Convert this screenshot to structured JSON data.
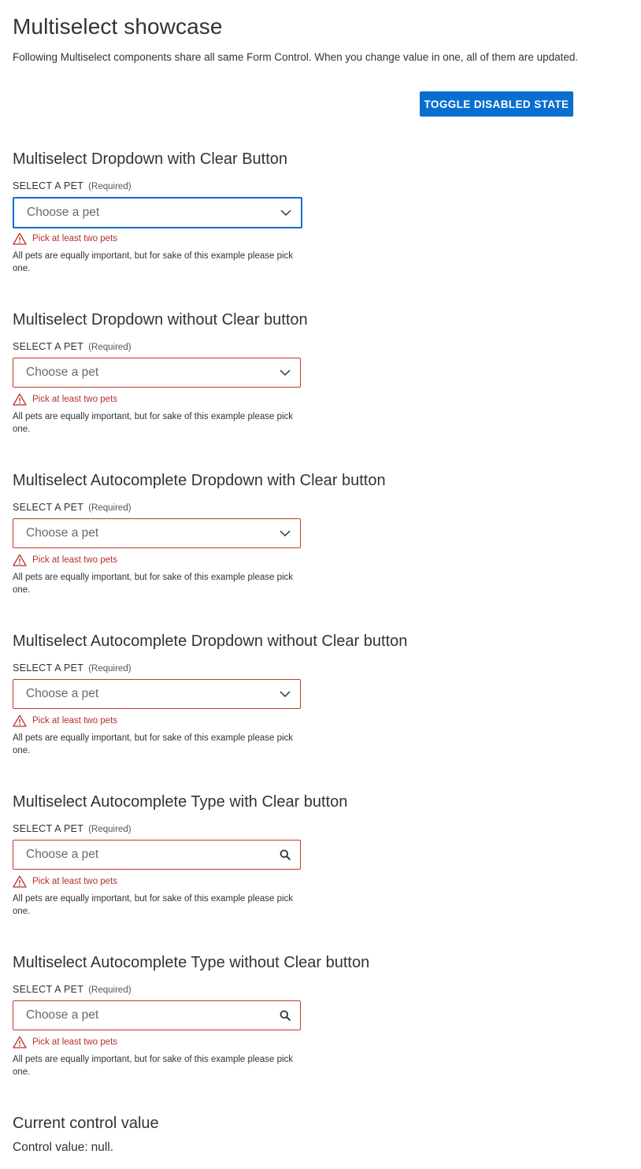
{
  "page": {
    "title": "Multiselect showcase",
    "description": "Following Multiselect components share all same Form Control. When you change value in one, all of them are updated.",
    "toggle_button_label": "TOGGLE DISABLED STATE"
  },
  "sections": [
    {
      "title": "Multiselect Dropdown with Clear Button",
      "label": "SELECT A PET",
      "required": "(Required)",
      "placeholder": "Choose a pet",
      "error": "Pick at least two pets",
      "help": "All pets are equally important, but for sake of this example please pick one.",
      "icon": "chevron-down-icon"
    },
    {
      "title": "Multiselect Dropdown without Clear button",
      "label": "SELECT A PET",
      "required": "(Required)",
      "placeholder": "Choose a pet",
      "error": "Pick at least two pets",
      "help": "All pets are equally important, but for sake of this example please pick one.",
      "icon": "chevron-down-icon"
    },
    {
      "title": "Multiselect Autocomplete Dropdown with Clear button",
      "label": "SELECT A PET",
      "required": "(Required)",
      "placeholder": "Choose a pet",
      "error": "Pick at least two pets",
      "help": "All pets are equally important, but for sake of this example please pick one.",
      "icon": "chevron-down-icon"
    },
    {
      "title": "Multiselect Autocomplete Dropdown without Clear button",
      "label": "SELECT A PET",
      "required": "(Required)",
      "placeholder": "Choose a pet",
      "error": "Pick at least two pets",
      "help": "All pets are equally important, but for sake of this example please pick one.",
      "icon": "chevron-down-icon"
    },
    {
      "title": "Multiselect Autocomplete Type with Clear button",
      "label": "SELECT A PET",
      "required": "(Required)",
      "placeholder": "Choose a pet",
      "error": "Pick at least two pets",
      "help": "All pets are equally important, but for sake of this example please pick one.",
      "icon": "search-icon"
    },
    {
      "title": "Multiselect Autocomplete Type without Clear button",
      "label": "SELECT A PET",
      "required": "(Required)",
      "placeholder": "Choose a pet",
      "error": "Pick at least two pets",
      "help": "All pets are equally important, but for sake of this example please pick one.",
      "icon": "search-icon"
    }
  ],
  "current_value": {
    "title": "Current control value",
    "label": "Control value:",
    "value": "null."
  },
  "colors": {
    "primary": "#0a6ed1",
    "error": "#b5312b",
    "error_border": "#c0392b",
    "text": "#333333"
  }
}
